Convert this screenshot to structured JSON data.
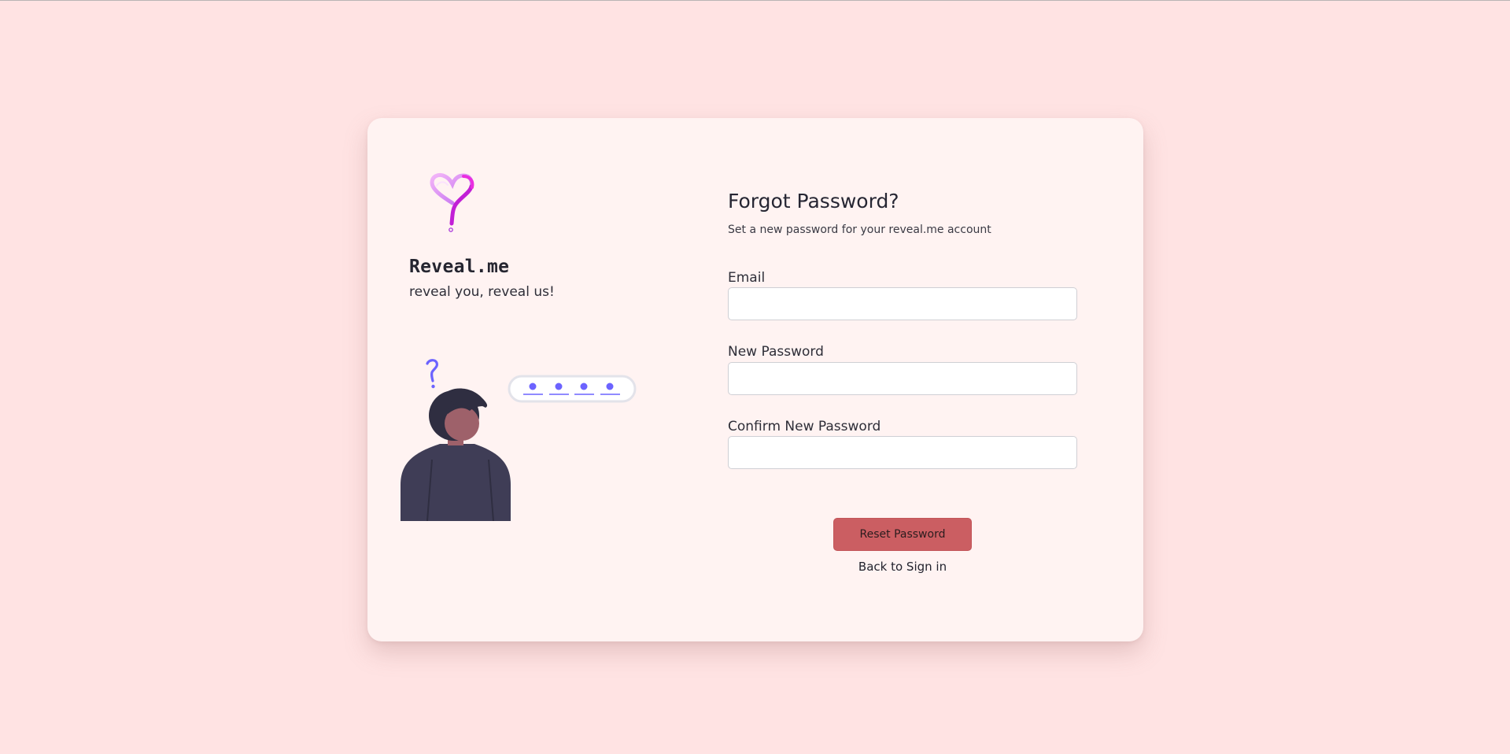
{
  "brand": {
    "name": "Reveal.me",
    "tagline": "reveal you, reveal us!",
    "logo_icon": "heart-question-mark-icon"
  },
  "illustration": {
    "icon": "confused-person-password-icon",
    "password_dots": 4
  },
  "form": {
    "title": "Forgot Password?",
    "subtitle": "Set a new password for your reveal.me account",
    "fields": [
      {
        "label": "Email",
        "value": "",
        "placeholder": ""
      },
      {
        "label": "New Password",
        "value": "",
        "placeholder": ""
      },
      {
        "label": "Confirm New Password",
        "value": "",
        "placeholder": ""
      }
    ],
    "submit_label": "Reset Password",
    "back_link": "Back to Sign in"
  },
  "colors": {
    "page_background": "#ffe3e3",
    "card_background": "#fff3f2",
    "button": "#cb5e62",
    "accent_purple": "#6c63ff",
    "logo_magenta": "#d321d3"
  }
}
